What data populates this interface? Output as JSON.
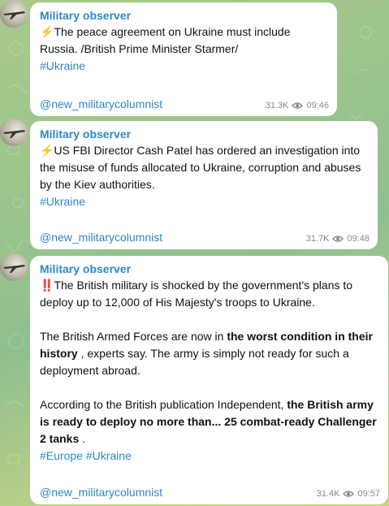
{
  "messages": [
    {
      "sender": "Military observer",
      "icon": "⚡",
      "text": "The peace agreement on Ukraine must include Russia. /British Prime Minister Starmer/",
      "hashtags": "#Ukraine",
      "signature": "@new_militarycolumnist",
      "views": "31.3K",
      "time": "09:46"
    },
    {
      "sender": "Military observer",
      "icon": "⚡",
      "text": "US FBI Director Cash Patel has ordered an investigation into the misuse of funds allocated to Ukraine, corruption and abuses by the Kiev authorities.",
      "hashtags": "#Ukraine",
      "signature": "@new_militarycolumnist",
      "views": "31.7K",
      "time": "09:48"
    },
    {
      "sender": "Military observer",
      "icon": "‼️",
      "p1": "The British military is shocked by the government's plans to deploy up to 12,000 of His Majesty's troops to Ukraine.",
      "p2_a": "The British Armed Forces are now in ",
      "p2_b": "the worst condition in their history",
      "p2_c": " , experts say. The army is simply not ready for such a deployment abroad.",
      "p3_a": "According to the British publication Independent, ",
      "p3_b": "the British army is ready to deploy no more than... 25 combat-ready Challenger 2 tanks",
      "p3_c": " .",
      "hashtags": "#Europe #Ukraine",
      "signature": "@new_militarycolumnist",
      "views": "31.4K",
      "time": "09:57"
    }
  ],
  "icons": {
    "views": "eye-icon",
    "avatar": "aircraft-avatar"
  },
  "colors": {
    "link": "#2f87c7",
    "meta": "#8a8a8a",
    "bubble": "#ffffff"
  }
}
